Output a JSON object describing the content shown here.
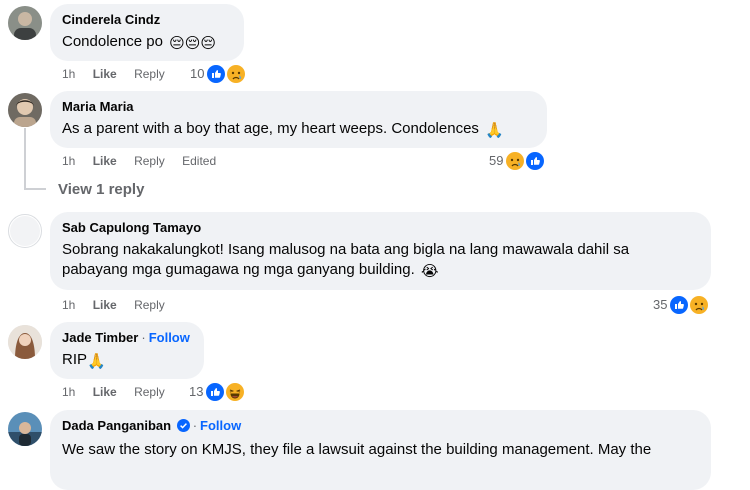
{
  "comments": [
    {
      "name": "Cinderela Cindz",
      "text": "Condolence po",
      "emojis": "😔😔😔",
      "time": "1h",
      "like": "Like",
      "reply": "Reply",
      "edited": "",
      "count": "10",
      "follow": ""
    },
    {
      "name": "Maria Maria",
      "text": "As a parent with a boy that age, my heart weeps. Condolences",
      "emojis": "🙏",
      "time": "1h",
      "like": "Like",
      "reply": "Reply",
      "edited": "Edited",
      "count": "59",
      "follow": ""
    },
    {
      "name": "Sab Capulong Tamayo",
      "text": "Sobrang nakakalungkot! Isang malusog na bata ang bigla na lang mawawala dahil sa pabayang mga gumagawa ng mga ganyang building.",
      "emojis": "😭",
      "time": "1h",
      "like": "Like",
      "reply": "Reply",
      "edited": "",
      "count": "35",
      "follow": ""
    },
    {
      "name": "Jade Timber",
      "text": "RIP",
      "emojis": "🙏",
      "time": "1h",
      "like": "Like",
      "reply": "Reply",
      "edited": "",
      "count": "13",
      "follow": "Follow"
    },
    {
      "name": "Dada Panganiban",
      "text": "We saw the story on KMJS, they file a lawsuit against the building management. May the",
      "emojis": "",
      "time": "",
      "like": "",
      "reply": "",
      "edited": "",
      "count": "",
      "follow": "Follow"
    }
  ],
  "separator": "·",
  "view_reply": "View 1 reply",
  "colors": {
    "link": "#0866ff",
    "meta": "#65676b",
    "bubble": "#f0f2f5"
  },
  "icons": [
    "like-reaction-icon",
    "sad-reaction-icon",
    "haha-reaction-icon",
    "verified-badge-icon"
  ]
}
